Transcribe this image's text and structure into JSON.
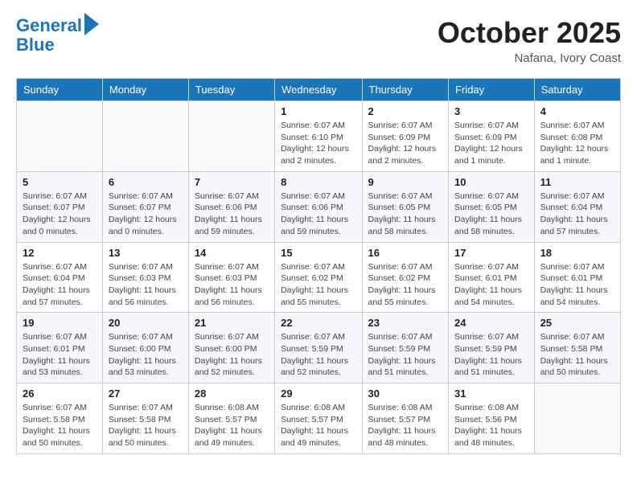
{
  "header": {
    "logo_line1": "General",
    "logo_line2": "Blue",
    "month": "October 2025",
    "location": "Nafana, Ivory Coast"
  },
  "weekdays": [
    "Sunday",
    "Monday",
    "Tuesday",
    "Wednesday",
    "Thursday",
    "Friday",
    "Saturday"
  ],
  "weeks": [
    [
      {
        "day": "",
        "info": ""
      },
      {
        "day": "",
        "info": ""
      },
      {
        "day": "",
        "info": ""
      },
      {
        "day": "1",
        "info": "Sunrise: 6:07 AM\nSunset: 6:10 PM\nDaylight: 12 hours\nand 2 minutes."
      },
      {
        "day": "2",
        "info": "Sunrise: 6:07 AM\nSunset: 6:09 PM\nDaylight: 12 hours\nand 2 minutes."
      },
      {
        "day": "3",
        "info": "Sunrise: 6:07 AM\nSunset: 6:09 PM\nDaylight: 12 hours\nand 1 minute."
      },
      {
        "day": "4",
        "info": "Sunrise: 6:07 AM\nSunset: 6:08 PM\nDaylight: 12 hours\nand 1 minute."
      }
    ],
    [
      {
        "day": "5",
        "info": "Sunrise: 6:07 AM\nSunset: 6:07 PM\nDaylight: 12 hours\nand 0 minutes."
      },
      {
        "day": "6",
        "info": "Sunrise: 6:07 AM\nSunset: 6:07 PM\nDaylight: 12 hours\nand 0 minutes."
      },
      {
        "day": "7",
        "info": "Sunrise: 6:07 AM\nSunset: 6:06 PM\nDaylight: 11 hours\nand 59 minutes."
      },
      {
        "day": "8",
        "info": "Sunrise: 6:07 AM\nSunset: 6:06 PM\nDaylight: 11 hours\nand 59 minutes."
      },
      {
        "day": "9",
        "info": "Sunrise: 6:07 AM\nSunset: 6:05 PM\nDaylight: 11 hours\nand 58 minutes."
      },
      {
        "day": "10",
        "info": "Sunrise: 6:07 AM\nSunset: 6:05 PM\nDaylight: 11 hours\nand 58 minutes."
      },
      {
        "day": "11",
        "info": "Sunrise: 6:07 AM\nSunset: 6:04 PM\nDaylight: 11 hours\nand 57 minutes."
      }
    ],
    [
      {
        "day": "12",
        "info": "Sunrise: 6:07 AM\nSunset: 6:04 PM\nDaylight: 11 hours\nand 57 minutes."
      },
      {
        "day": "13",
        "info": "Sunrise: 6:07 AM\nSunset: 6:03 PM\nDaylight: 11 hours\nand 56 minutes."
      },
      {
        "day": "14",
        "info": "Sunrise: 6:07 AM\nSunset: 6:03 PM\nDaylight: 11 hours\nand 56 minutes."
      },
      {
        "day": "15",
        "info": "Sunrise: 6:07 AM\nSunset: 6:02 PM\nDaylight: 11 hours\nand 55 minutes."
      },
      {
        "day": "16",
        "info": "Sunrise: 6:07 AM\nSunset: 6:02 PM\nDaylight: 11 hours\nand 55 minutes."
      },
      {
        "day": "17",
        "info": "Sunrise: 6:07 AM\nSunset: 6:01 PM\nDaylight: 11 hours\nand 54 minutes."
      },
      {
        "day": "18",
        "info": "Sunrise: 6:07 AM\nSunset: 6:01 PM\nDaylight: 11 hours\nand 54 minutes."
      }
    ],
    [
      {
        "day": "19",
        "info": "Sunrise: 6:07 AM\nSunset: 6:01 PM\nDaylight: 11 hours\nand 53 minutes."
      },
      {
        "day": "20",
        "info": "Sunrise: 6:07 AM\nSunset: 6:00 PM\nDaylight: 11 hours\nand 53 minutes."
      },
      {
        "day": "21",
        "info": "Sunrise: 6:07 AM\nSunset: 6:00 PM\nDaylight: 11 hours\nand 52 minutes."
      },
      {
        "day": "22",
        "info": "Sunrise: 6:07 AM\nSunset: 5:59 PM\nDaylight: 11 hours\nand 52 minutes."
      },
      {
        "day": "23",
        "info": "Sunrise: 6:07 AM\nSunset: 5:59 PM\nDaylight: 11 hours\nand 51 minutes."
      },
      {
        "day": "24",
        "info": "Sunrise: 6:07 AM\nSunset: 5:59 PM\nDaylight: 11 hours\nand 51 minutes."
      },
      {
        "day": "25",
        "info": "Sunrise: 6:07 AM\nSunset: 5:58 PM\nDaylight: 11 hours\nand 50 minutes."
      }
    ],
    [
      {
        "day": "26",
        "info": "Sunrise: 6:07 AM\nSunset: 5:58 PM\nDaylight: 11 hours\nand 50 minutes."
      },
      {
        "day": "27",
        "info": "Sunrise: 6:07 AM\nSunset: 5:58 PM\nDaylight: 11 hours\nand 50 minutes."
      },
      {
        "day": "28",
        "info": "Sunrise: 6:08 AM\nSunset: 5:57 PM\nDaylight: 11 hours\nand 49 minutes."
      },
      {
        "day": "29",
        "info": "Sunrise: 6:08 AM\nSunset: 5:57 PM\nDaylight: 11 hours\nand 49 minutes."
      },
      {
        "day": "30",
        "info": "Sunrise: 6:08 AM\nSunset: 5:57 PM\nDaylight: 11 hours\nand 48 minutes."
      },
      {
        "day": "31",
        "info": "Sunrise: 6:08 AM\nSunset: 5:56 PM\nDaylight: 11 hours\nand 48 minutes."
      },
      {
        "day": "",
        "info": ""
      }
    ]
  ]
}
